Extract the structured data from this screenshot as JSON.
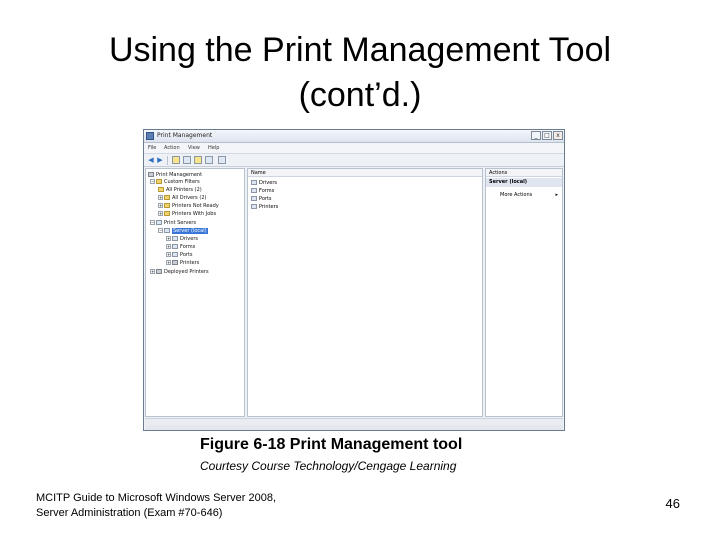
{
  "slide": {
    "title_line1": "Using the Print Management Tool",
    "title_line2": "(cont’d.)",
    "caption": "Figure 6-18 Print Management tool",
    "credit": "Courtesy Course Technology/Cengage Learning",
    "footer_line1": "MCITP Guide to Microsoft Windows Server 2008,",
    "footer_line2": "Server Administration (Exam #70-646)",
    "page_number": "46"
  },
  "window": {
    "title": "Print Management",
    "buttons": {
      "minimize": "_",
      "maximize": "□",
      "close": "x"
    },
    "menu": [
      "File",
      "Action",
      "View",
      "Help"
    ],
    "toolbar_icons": [
      "back-arrow-icon",
      "forward-arrow-icon",
      "folder-icon",
      "help-icon",
      "properties-icon",
      "console-icon"
    ]
  },
  "tree": {
    "items": [
      {
        "label": "Print Management",
        "icon": "printer-icon"
      },
      {
        "label": "Custom Filters",
        "icon": "filter-icon"
      },
      {
        "label": "All Printers (2)",
        "icon": "filter-icon"
      },
      {
        "label": "All Drivers (2)",
        "icon": "filter-icon"
      },
      {
        "label": "Printers Not Ready",
        "icon": "filter-icon"
      },
      {
        "label": "Printers With Jobs",
        "icon": "filter-icon"
      },
      {
        "label": "Print Servers",
        "icon": "server-icon"
      },
      {
        "label": "Server (local)",
        "icon": "server-icon"
      },
      {
        "label": "Drivers",
        "icon": "driver-icon"
      },
      {
        "label": "Forms",
        "icon": "form-icon"
      },
      {
        "label": "Ports",
        "icon": "port-icon"
      },
      {
        "label": "Printers",
        "icon": "printer-icon"
      },
      {
        "label": "Deployed Printers",
        "icon": "printer-icon"
      }
    ]
  },
  "list": {
    "column_header": "Name",
    "items": [
      "Drivers",
      "Forms",
      "Ports",
      "Printers"
    ]
  },
  "actions": {
    "header": "Actions",
    "group": "Server (local)",
    "item": "More Actions",
    "item_arrow": "▸"
  }
}
